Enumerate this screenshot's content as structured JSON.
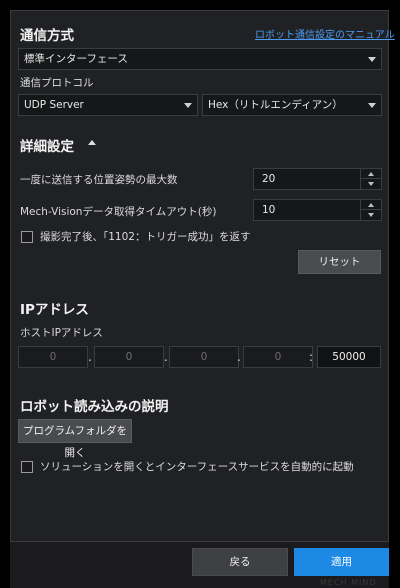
{
  "comm": {
    "title": "通信方式",
    "manual_link": "ロボット通信設定のマニュアル",
    "interface_select": "標準インターフェース",
    "protocol_label": "通信プロトコル",
    "protocol_select": "UDP Server",
    "format_select": "Hex（リトルエンディアン）"
  },
  "details": {
    "title": "詳細設定",
    "max_poses_label": "一度に送信する位置姿勢の最大数",
    "max_poses_value": "20",
    "timeout_label": "Mech-Visionデータ取得タイムアウト(秒)",
    "timeout_value": "10",
    "return_1102_label": "撮影完了後、「1102：トリガー成功」を返す",
    "return_1102_checked": false,
    "reset_button": "リセット"
  },
  "ip": {
    "title": "IPアドレス",
    "host_label": "ホストIPアドレス",
    "octets": [
      "0",
      "0",
      "0",
      "0"
    ],
    "separator": ".",
    "port_separator": ":",
    "port": "50000"
  },
  "robot_load": {
    "title": "ロボット読み込みの説明",
    "open_folder_button": "プログラムフォルダを開く",
    "auto_start_label": "ソリューションを開くとインターフェースサービスを自動的に起動",
    "auto_start_checked": false
  },
  "footer": {
    "back_button": "戻る",
    "apply_button": "適用",
    "watermark": "MECH MIND"
  },
  "colors": {
    "accent": "#1e88e5",
    "link": "#4d9cf4",
    "panel_bg": "#202124"
  },
  "icons": {
    "collapse": "caret-up-icon",
    "dropdown": "chevron-down-icon",
    "spin_up": "spin-up-icon",
    "spin_down": "spin-down-icon"
  }
}
